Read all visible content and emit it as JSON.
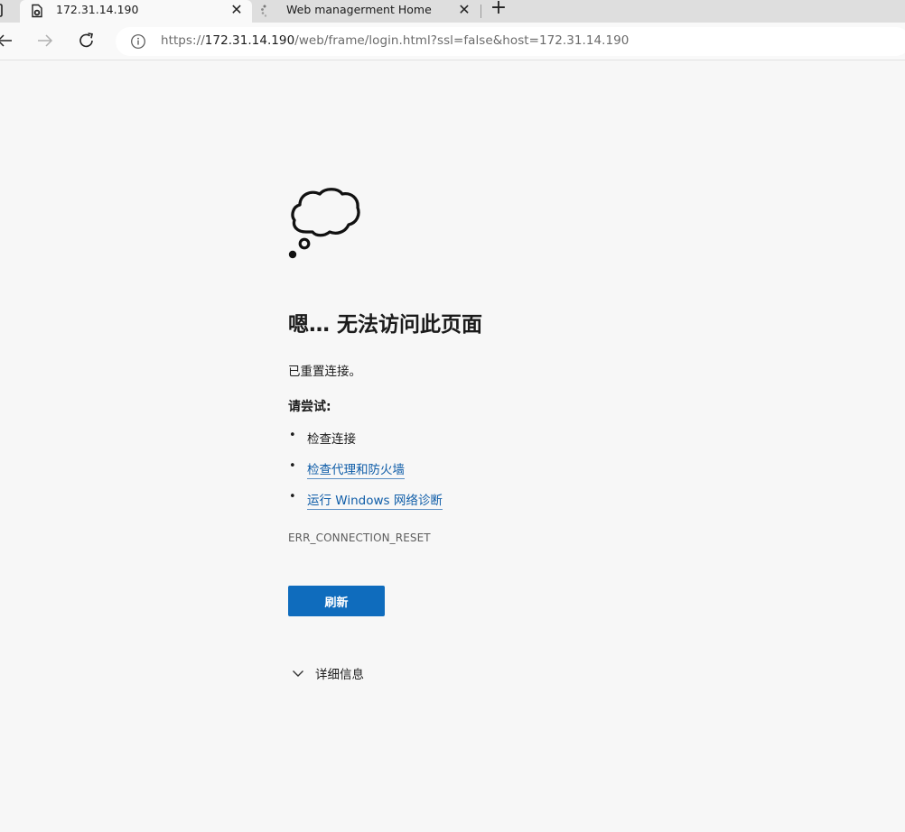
{
  "browser": {
    "tabs": [
      {
        "title": "172.31.14.190",
        "icon": "page-error-icon",
        "active": true
      },
      {
        "title": "Web managerment Home",
        "icon": "loading-spinner-icon",
        "active": false
      }
    ],
    "close_glyph": "✕",
    "new_tab_glyph": "+",
    "address": {
      "scheme": "https://",
      "host": "172.31.14.190",
      "rest": "/web/frame/login.html?ssl=false&host=172.31.14.190"
    }
  },
  "error": {
    "icon": "thought-cloud-icon",
    "heading": "嗯… 无法访问此页面",
    "description": "已重置连接。",
    "try_label": "请尝试:",
    "bullet": "•",
    "suggestions": [
      {
        "text": "检查连接",
        "link": false
      },
      {
        "text": "检查代理和防火墙",
        "link": true
      },
      {
        "text": "运行 Windows 网络诊断",
        "link": true
      }
    ],
    "code": "ERR_CONNECTION_RESET",
    "refresh_label": "刷新",
    "details_label": "详细信息"
  },
  "colors": {
    "page_bg": "#f7f7f7",
    "link": "#0f5da8",
    "button": "#0f6cbd",
    "tabstrip": "#dedede"
  }
}
